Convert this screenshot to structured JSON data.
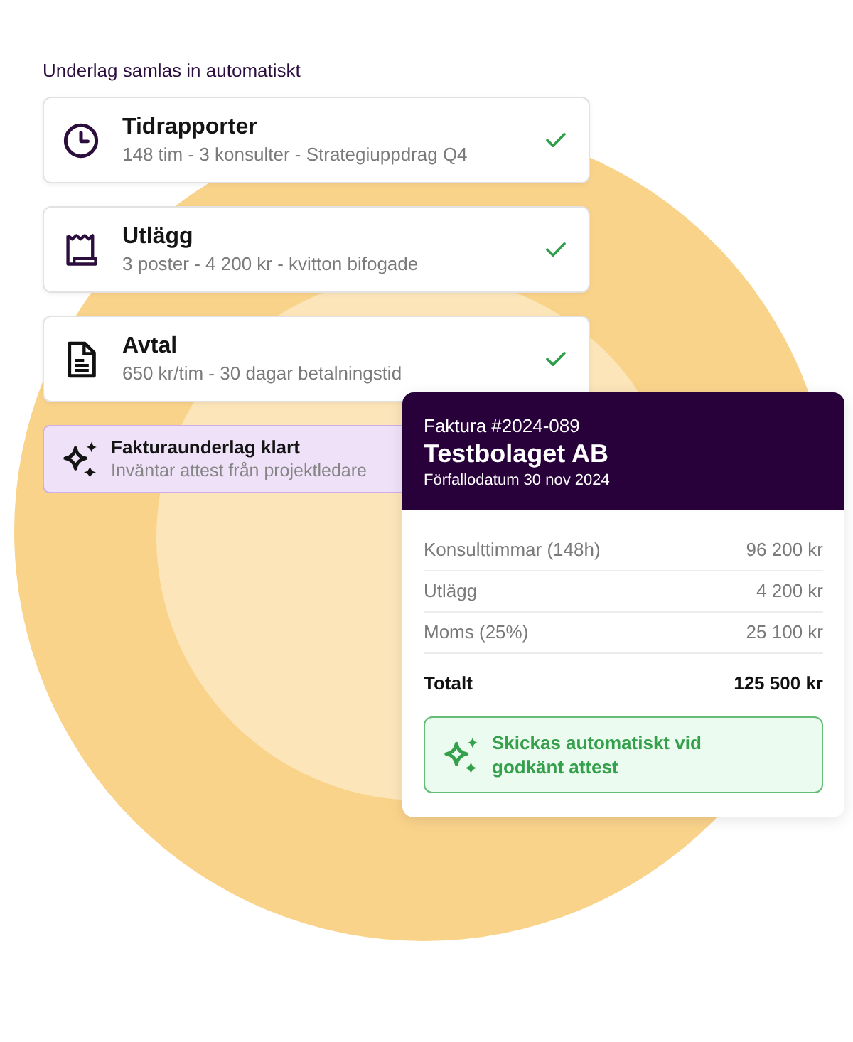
{
  "heading": "Underlag samlas in automatiskt",
  "sources": [
    {
      "kind": "clock",
      "title": "Tidrapporter",
      "detail": "148 tim - 3 konsulter - Strategiuppdrag Q4",
      "done": true
    },
    {
      "kind": "receipt",
      "title": "Utlägg",
      "detail": "3 poster - 4 200 kr - kvitton bifogade",
      "done": true
    },
    {
      "kind": "document",
      "title": "Avtal",
      "detail": "650 kr/tim - 30 dagar betalningstid",
      "done": true
    }
  ],
  "status": {
    "title": "Fakturaunderlag klart",
    "detail": "Inväntar attest från projektledare"
  },
  "invoice": {
    "number": "Faktura #2024-089",
    "customer": "Testbolaget AB",
    "due_date": "Förfallodatum 30 nov 2024",
    "lines": [
      {
        "label": "Konsulttimmar (148h)",
        "amount": "96 200 kr"
      },
      {
        "label": "Utlägg",
        "amount": "4 200 kr"
      },
      {
        "label": "Moms (25%)",
        "amount": "25 100 kr"
      }
    ],
    "total": {
      "label": "Totalt",
      "amount": "125 500 kr"
    },
    "notice": "Skickas automatiskt vid godkänt attest"
  }
}
